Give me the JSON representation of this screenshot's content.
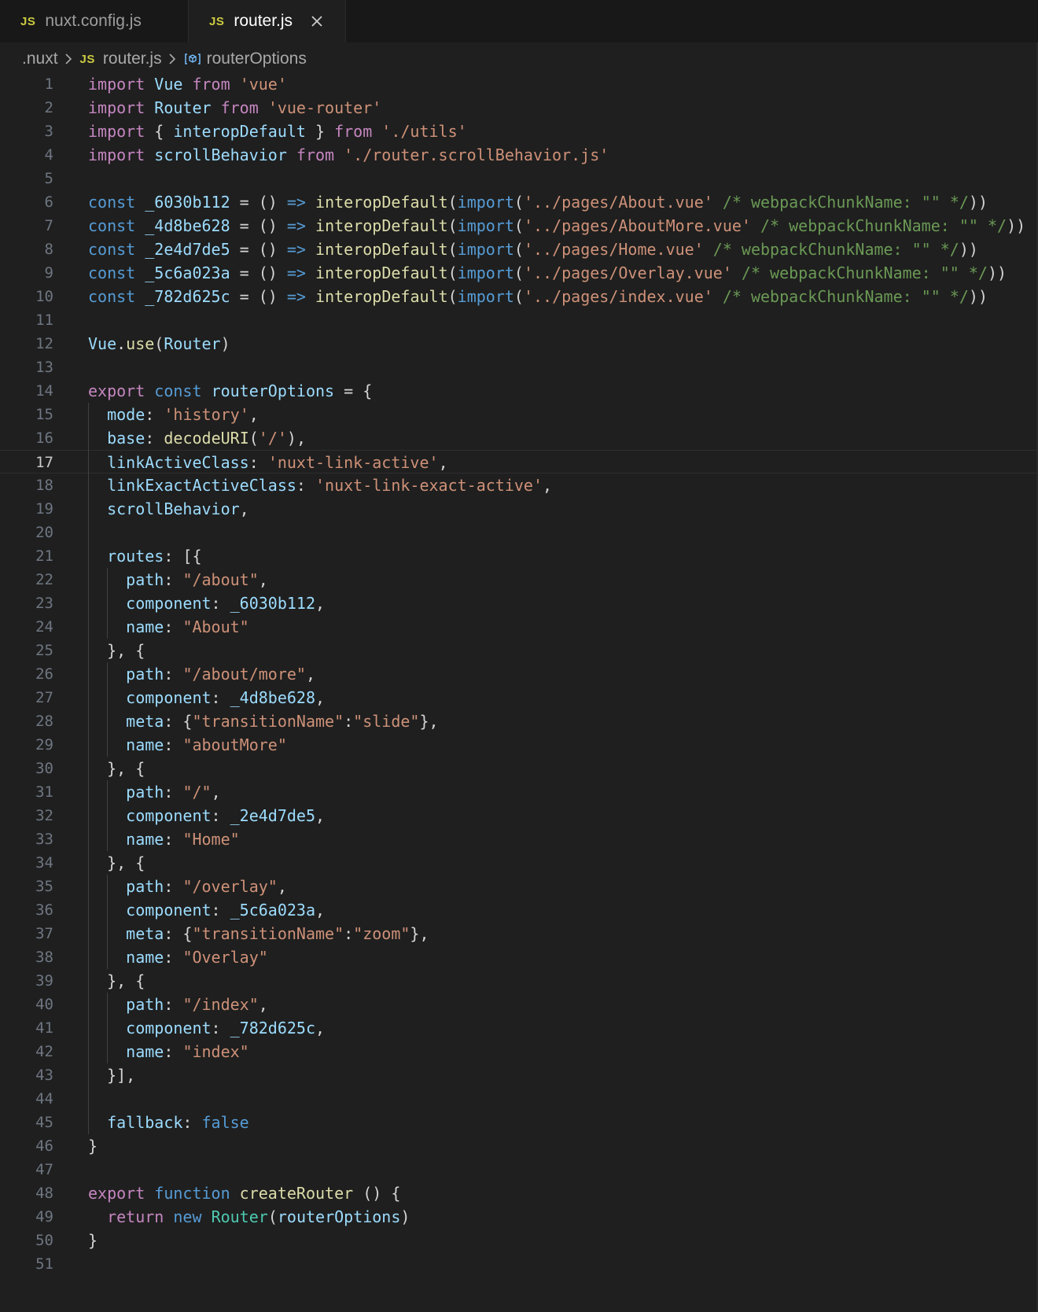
{
  "tabs": [
    {
      "badge": "JS",
      "label": "nuxt.config.js",
      "active": false
    },
    {
      "badge": "JS",
      "label": "router.js",
      "active": true
    }
  ],
  "breadcrumb": {
    "folder": ".nuxt",
    "file_badge": "JS",
    "file": "router.js",
    "symbol": "routerOptions"
  },
  "editor": {
    "current_line": 17,
    "lines": [
      [
        [
          "kw",
          "import"
        ],
        [
          "t",
          " "
        ],
        [
          "var",
          "Vue"
        ],
        [
          "t",
          " "
        ],
        [
          "kw",
          "from"
        ],
        [
          "t",
          " "
        ],
        [
          "str",
          "'vue'"
        ]
      ],
      [
        [
          "kw",
          "import"
        ],
        [
          "t",
          " "
        ],
        [
          "var",
          "Router"
        ],
        [
          "t",
          " "
        ],
        [
          "kw",
          "from"
        ],
        [
          "t",
          " "
        ],
        [
          "str",
          "'vue-router'"
        ]
      ],
      [
        [
          "kw",
          "import"
        ],
        [
          "t",
          " { "
        ],
        [
          "var",
          "interopDefault"
        ],
        [
          "t",
          " } "
        ],
        [
          "kw",
          "from"
        ],
        [
          "t",
          " "
        ],
        [
          "str",
          "'./utils'"
        ]
      ],
      [
        [
          "kw",
          "import"
        ],
        [
          "t",
          " "
        ],
        [
          "var",
          "scrollBehavior"
        ],
        [
          "t",
          " "
        ],
        [
          "kw",
          "from"
        ],
        [
          "t",
          " "
        ],
        [
          "str",
          "'./router.scrollBehavior.js'"
        ]
      ],
      [],
      [
        [
          "dec",
          "const"
        ],
        [
          "t",
          " "
        ],
        [
          "var",
          "_6030b112"
        ],
        [
          "t",
          " = () "
        ],
        [
          "dec",
          "=>"
        ],
        [
          "t",
          " "
        ],
        [
          "fn",
          "interopDefault"
        ],
        [
          "t",
          "("
        ],
        [
          "dec",
          "import"
        ],
        [
          "t",
          "("
        ],
        [
          "str",
          "'../pages/About.vue'"
        ],
        [
          "t",
          " "
        ],
        [
          "cmt",
          "/* webpackChunkName: \"\" */"
        ],
        [
          "t",
          "))"
        ]
      ],
      [
        [
          "dec",
          "const"
        ],
        [
          "t",
          " "
        ],
        [
          "var",
          "_4d8be628"
        ],
        [
          "t",
          " = () "
        ],
        [
          "dec",
          "=>"
        ],
        [
          "t",
          " "
        ],
        [
          "fn",
          "interopDefault"
        ],
        [
          "t",
          "("
        ],
        [
          "dec",
          "import"
        ],
        [
          "t",
          "("
        ],
        [
          "str",
          "'../pages/AboutMore.vue'"
        ],
        [
          "t",
          " "
        ],
        [
          "cmt",
          "/* webpackChunkName: \"\" */"
        ],
        [
          "t",
          "))"
        ]
      ],
      [
        [
          "dec",
          "const"
        ],
        [
          "t",
          " "
        ],
        [
          "var",
          "_2e4d7de5"
        ],
        [
          "t",
          " = () "
        ],
        [
          "dec",
          "=>"
        ],
        [
          "t",
          " "
        ],
        [
          "fn",
          "interopDefault"
        ],
        [
          "t",
          "("
        ],
        [
          "dec",
          "import"
        ],
        [
          "t",
          "("
        ],
        [
          "str",
          "'../pages/Home.vue'"
        ],
        [
          "t",
          " "
        ],
        [
          "cmt",
          "/* webpackChunkName: \"\" */"
        ],
        [
          "t",
          "))"
        ]
      ],
      [
        [
          "dec",
          "const"
        ],
        [
          "t",
          " "
        ],
        [
          "var",
          "_5c6a023a"
        ],
        [
          "t",
          " = () "
        ],
        [
          "dec",
          "=>"
        ],
        [
          "t",
          " "
        ],
        [
          "fn",
          "interopDefault"
        ],
        [
          "t",
          "("
        ],
        [
          "dec",
          "import"
        ],
        [
          "t",
          "("
        ],
        [
          "str",
          "'../pages/Overlay.vue'"
        ],
        [
          "t",
          " "
        ],
        [
          "cmt",
          "/* webpackChunkName: \"\" */"
        ],
        [
          "t",
          "))"
        ]
      ],
      [
        [
          "dec",
          "const"
        ],
        [
          "t",
          " "
        ],
        [
          "var",
          "_782d625c"
        ],
        [
          "t",
          " = () "
        ],
        [
          "dec",
          "=>"
        ],
        [
          "t",
          " "
        ],
        [
          "fn",
          "interopDefault"
        ],
        [
          "t",
          "("
        ],
        [
          "dec",
          "import"
        ],
        [
          "t",
          "("
        ],
        [
          "str",
          "'../pages/index.vue'"
        ],
        [
          "t",
          " "
        ],
        [
          "cmt",
          "/* webpackChunkName: \"\" */"
        ],
        [
          "t",
          "))"
        ]
      ],
      [],
      [
        [
          "var",
          "Vue"
        ],
        [
          "t",
          "."
        ],
        [
          "fn",
          "use"
        ],
        [
          "t",
          "("
        ],
        [
          "var",
          "Router"
        ],
        [
          "t",
          ")"
        ]
      ],
      [],
      [
        [
          "kw",
          "export"
        ],
        [
          "t",
          " "
        ],
        [
          "dec",
          "const"
        ],
        [
          "t",
          " "
        ],
        [
          "var",
          "routerOptions"
        ],
        [
          "t",
          " = {"
        ]
      ],
      [
        [
          "t",
          "  "
        ],
        [
          "var",
          "mode"
        ],
        [
          "t",
          ": "
        ],
        [
          "str",
          "'history'"
        ],
        [
          "t",
          ","
        ]
      ],
      [
        [
          "t",
          "  "
        ],
        [
          "var",
          "base"
        ],
        [
          "t",
          ": "
        ],
        [
          "fn",
          "decodeURI"
        ],
        [
          "t",
          "("
        ],
        [
          "str",
          "'/'"
        ],
        [
          "t",
          "),"
        ]
      ],
      [
        [
          "t",
          "  "
        ],
        [
          "var",
          "linkActiveClass"
        ],
        [
          "t",
          ": "
        ],
        [
          "str",
          "'nuxt-link-active'"
        ],
        [
          "t",
          ","
        ]
      ],
      [
        [
          "t",
          "  "
        ],
        [
          "var",
          "linkExactActiveClass"
        ],
        [
          "t",
          ": "
        ],
        [
          "str",
          "'nuxt-link-exact-active'"
        ],
        [
          "t",
          ","
        ]
      ],
      [
        [
          "t",
          "  "
        ],
        [
          "var",
          "scrollBehavior"
        ],
        [
          "t",
          ","
        ]
      ],
      [],
      [
        [
          "t",
          "  "
        ],
        [
          "var",
          "routes"
        ],
        [
          "t",
          ": [{"
        ]
      ],
      [
        [
          "t",
          "    "
        ],
        [
          "var",
          "path"
        ],
        [
          "t",
          ": "
        ],
        [
          "str",
          "\"/about\""
        ],
        [
          "t",
          ","
        ]
      ],
      [
        [
          "t",
          "    "
        ],
        [
          "var",
          "component"
        ],
        [
          "t",
          ": "
        ],
        [
          "var",
          "_6030b112"
        ],
        [
          "t",
          ","
        ]
      ],
      [
        [
          "t",
          "    "
        ],
        [
          "var",
          "name"
        ],
        [
          "t",
          ": "
        ],
        [
          "str",
          "\"About\""
        ]
      ],
      [
        [
          "t",
          "  }, {"
        ]
      ],
      [
        [
          "t",
          "    "
        ],
        [
          "var",
          "path"
        ],
        [
          "t",
          ": "
        ],
        [
          "str",
          "\"/about/more\""
        ],
        [
          "t",
          ","
        ]
      ],
      [
        [
          "t",
          "    "
        ],
        [
          "var",
          "component"
        ],
        [
          "t",
          ": "
        ],
        [
          "var",
          "_4d8be628"
        ],
        [
          "t",
          ","
        ]
      ],
      [
        [
          "t",
          "    "
        ],
        [
          "var",
          "meta"
        ],
        [
          "t",
          ": {"
        ],
        [
          "str",
          "\"transitionName\""
        ],
        [
          "t",
          ":"
        ],
        [
          "str",
          "\"slide\""
        ],
        [
          "t",
          "},"
        ]
      ],
      [
        [
          "t",
          "    "
        ],
        [
          "var",
          "name"
        ],
        [
          "t",
          ": "
        ],
        [
          "str",
          "\"aboutMore\""
        ]
      ],
      [
        [
          "t",
          "  }, {"
        ]
      ],
      [
        [
          "t",
          "    "
        ],
        [
          "var",
          "path"
        ],
        [
          "t",
          ": "
        ],
        [
          "str",
          "\"/\""
        ],
        [
          "t",
          ","
        ]
      ],
      [
        [
          "t",
          "    "
        ],
        [
          "var",
          "component"
        ],
        [
          "t",
          ": "
        ],
        [
          "var",
          "_2e4d7de5"
        ],
        [
          "t",
          ","
        ]
      ],
      [
        [
          "t",
          "    "
        ],
        [
          "var",
          "name"
        ],
        [
          "t",
          ": "
        ],
        [
          "str",
          "\"Home\""
        ]
      ],
      [
        [
          "t",
          "  }, {"
        ]
      ],
      [
        [
          "t",
          "    "
        ],
        [
          "var",
          "path"
        ],
        [
          "t",
          ": "
        ],
        [
          "str",
          "\"/overlay\""
        ],
        [
          "t",
          ","
        ]
      ],
      [
        [
          "t",
          "    "
        ],
        [
          "var",
          "component"
        ],
        [
          "t",
          ": "
        ],
        [
          "var",
          "_5c6a023a"
        ],
        [
          "t",
          ","
        ]
      ],
      [
        [
          "t",
          "    "
        ],
        [
          "var",
          "meta"
        ],
        [
          "t",
          ": {"
        ],
        [
          "str",
          "\"transitionName\""
        ],
        [
          "t",
          ":"
        ],
        [
          "str",
          "\"zoom\""
        ],
        [
          "t",
          "},"
        ]
      ],
      [
        [
          "t",
          "    "
        ],
        [
          "var",
          "name"
        ],
        [
          "t",
          ": "
        ],
        [
          "str",
          "\"Overlay\""
        ]
      ],
      [
        [
          "t",
          "  }, {"
        ]
      ],
      [
        [
          "t",
          "    "
        ],
        [
          "var",
          "path"
        ],
        [
          "t",
          ": "
        ],
        [
          "str",
          "\"/index\""
        ],
        [
          "t",
          ","
        ]
      ],
      [
        [
          "t",
          "    "
        ],
        [
          "var",
          "component"
        ],
        [
          "t",
          ": "
        ],
        [
          "var",
          "_782d625c"
        ],
        [
          "t",
          ","
        ]
      ],
      [
        [
          "t",
          "    "
        ],
        [
          "var",
          "name"
        ],
        [
          "t",
          ": "
        ],
        [
          "str",
          "\"index\""
        ]
      ],
      [
        [
          "t",
          "  }],"
        ]
      ],
      [],
      [
        [
          "t",
          "  "
        ],
        [
          "var",
          "fallback"
        ],
        [
          "t",
          ": "
        ],
        [
          "bool",
          "false"
        ]
      ],
      [
        [
          "t",
          "}"
        ]
      ],
      [],
      [
        [
          "kw",
          "export"
        ],
        [
          "t",
          " "
        ],
        [
          "dec",
          "function"
        ],
        [
          "t",
          " "
        ],
        [
          "fn",
          "createRouter"
        ],
        [
          "t",
          " () {"
        ]
      ],
      [
        [
          "t",
          "  "
        ],
        [
          "kw",
          "return"
        ],
        [
          "t",
          " "
        ],
        [
          "dec",
          "new"
        ],
        [
          "t",
          " "
        ],
        [
          "cls",
          "Router"
        ],
        [
          "t",
          "("
        ],
        [
          "var",
          "routerOptions"
        ],
        [
          "t",
          ")"
        ]
      ],
      [
        [
          "t",
          "}"
        ]
      ],
      []
    ]
  }
}
